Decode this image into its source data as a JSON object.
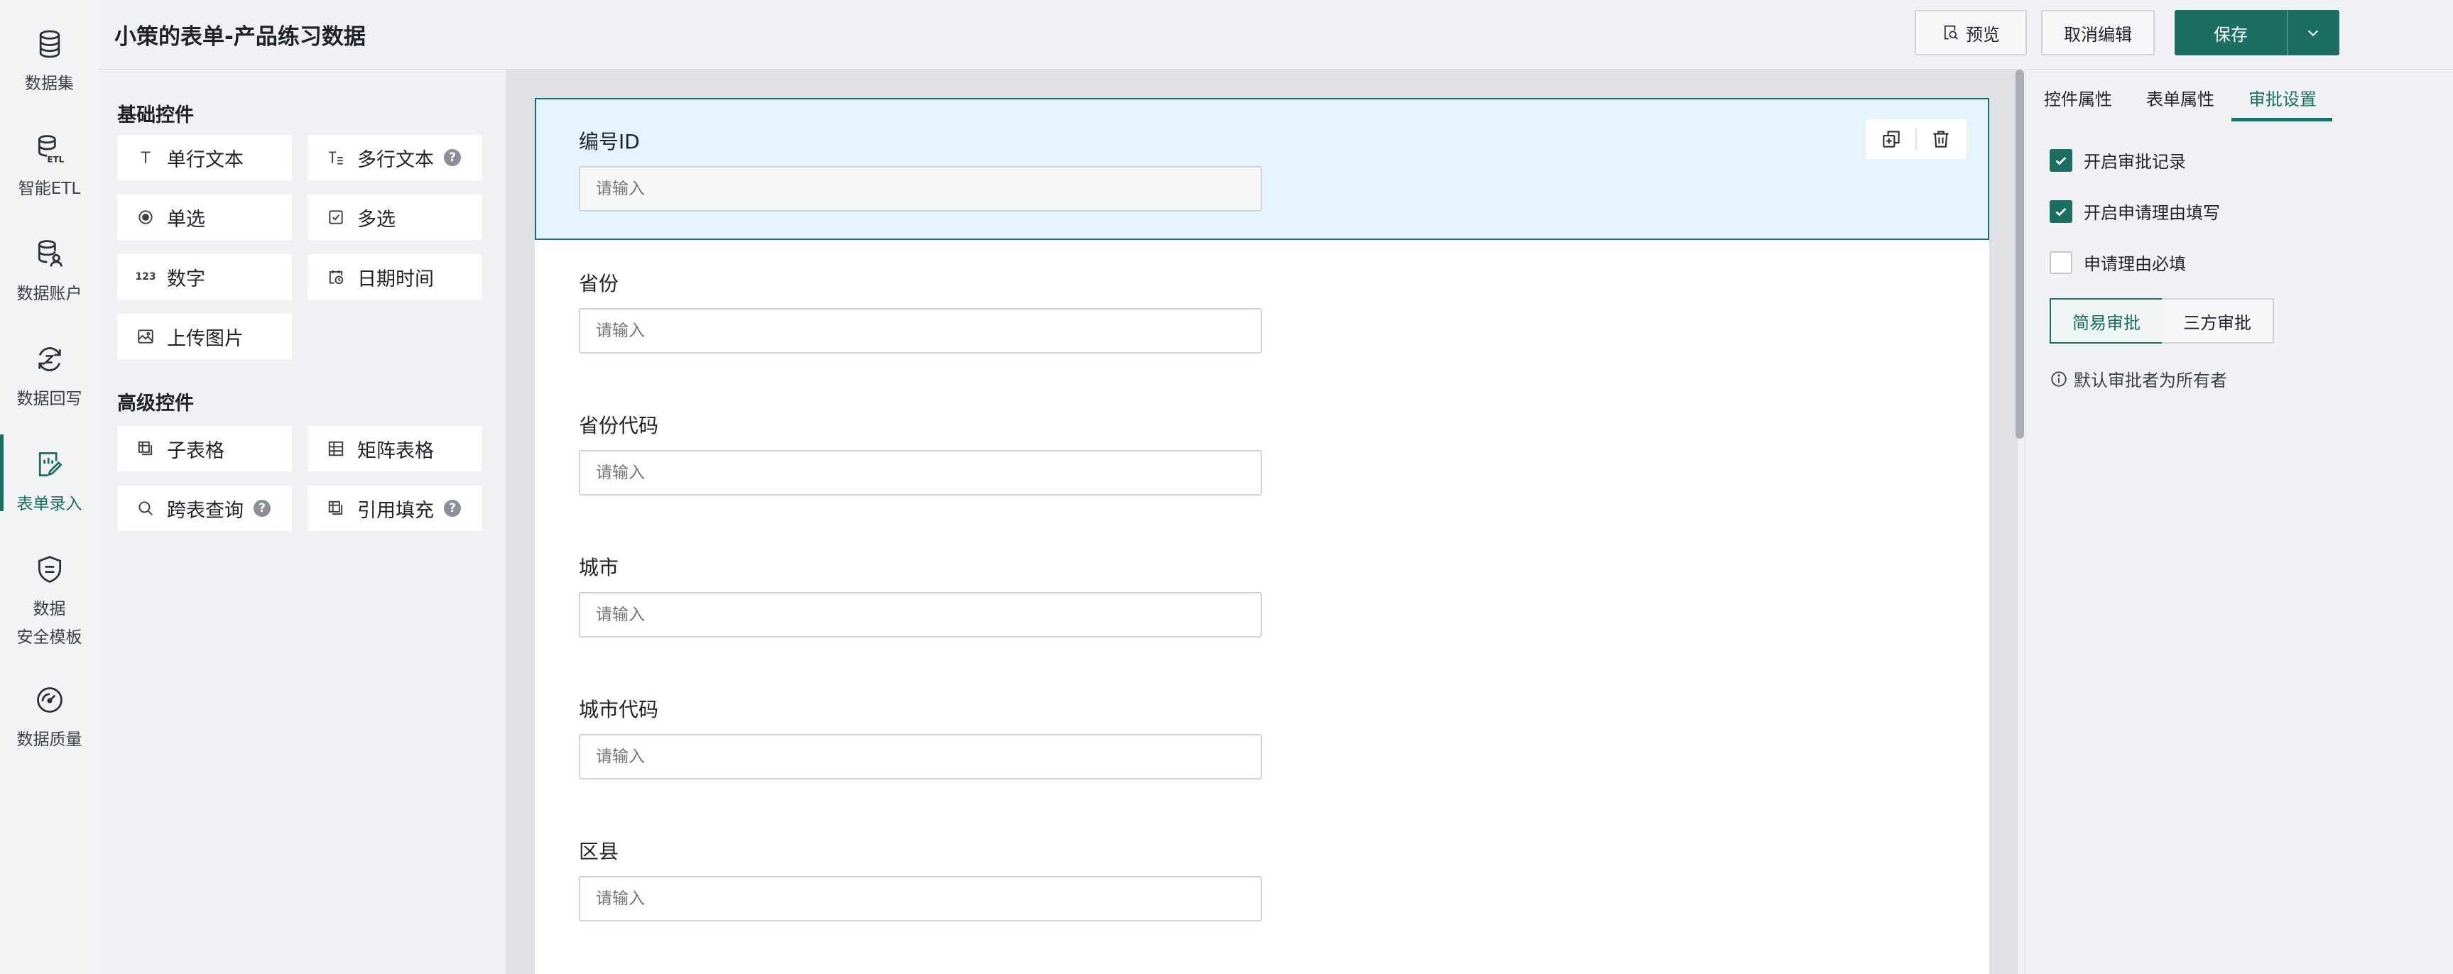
{
  "app": {
    "title": "小策的表单-产品练习数据"
  },
  "nav": {
    "items": [
      {
        "label": "数据集",
        "icon": "database-icon"
      },
      {
        "label": "智能ETL",
        "icon": "etl-icon"
      },
      {
        "label": "数据账户",
        "icon": "data-account-icon"
      },
      {
        "label": "数据回写",
        "icon": "data-writeback-icon"
      },
      {
        "label": "表单录入",
        "icon": "form-entry-icon",
        "active": true
      },
      {
        "label": "数据\n安全模板",
        "icon": "shield-template-icon"
      },
      {
        "label": "数据质量",
        "icon": "gauge-icon"
      }
    ]
  },
  "header": {
    "preview_label": "预览",
    "cancel_label": "取消编辑",
    "save_label": "保存"
  },
  "palette": {
    "basic_title": "基础控件",
    "advanced_title": "高级控件",
    "basic": [
      {
        "label": "单行文本",
        "icon": "single-line-text-icon"
      },
      {
        "label": "多行文本",
        "icon": "multi-line-text-icon",
        "help": true
      },
      {
        "label": "单选",
        "icon": "radio-icon"
      },
      {
        "label": "多选",
        "icon": "checkbox-icon"
      },
      {
        "label": "数字",
        "icon": "number-icon"
      },
      {
        "label": "日期时间",
        "icon": "datetime-icon"
      },
      {
        "label": "上传图片",
        "icon": "image-upload-icon"
      }
    ],
    "advanced": [
      {
        "label": "子表格",
        "icon": "sub-table-icon"
      },
      {
        "label": "矩阵表格",
        "icon": "matrix-table-icon"
      },
      {
        "label": "跨表查询",
        "icon": "search-icon",
        "help": true
      },
      {
        "label": "引用填充",
        "icon": "reference-fill-icon",
        "help": true
      }
    ],
    "help_glyph": "?",
    "number_glyph": "123"
  },
  "form": {
    "fields": [
      {
        "label": "编号ID",
        "placeholder": "请输入",
        "selected": true
      },
      {
        "label": "省份",
        "placeholder": "请输入"
      },
      {
        "label": "省份代码",
        "placeholder": "请输入"
      },
      {
        "label": "城市",
        "placeholder": "请输入"
      },
      {
        "label": "城市代码",
        "placeholder": "请输入"
      },
      {
        "label": "区县",
        "placeholder": "请输入"
      }
    ]
  },
  "right_panel": {
    "tabs": [
      {
        "label": "控件属性"
      },
      {
        "label": "表单属性"
      },
      {
        "label": "审批设置",
        "active": true
      }
    ],
    "checkboxes": [
      {
        "label": "开启审批记录",
        "checked": true
      },
      {
        "label": "开启申请理由填写",
        "checked": true
      },
      {
        "label": "申请理由必填",
        "checked": false
      }
    ],
    "approval_modes": [
      {
        "label": "简易审批",
        "selected": true
      },
      {
        "label": "三方审批",
        "selected": false
      }
    ],
    "info_text": "默认审批者为所有者"
  },
  "colors": {
    "accent": "#1b6e62",
    "selected_field_bg": "#e5f3fd"
  }
}
